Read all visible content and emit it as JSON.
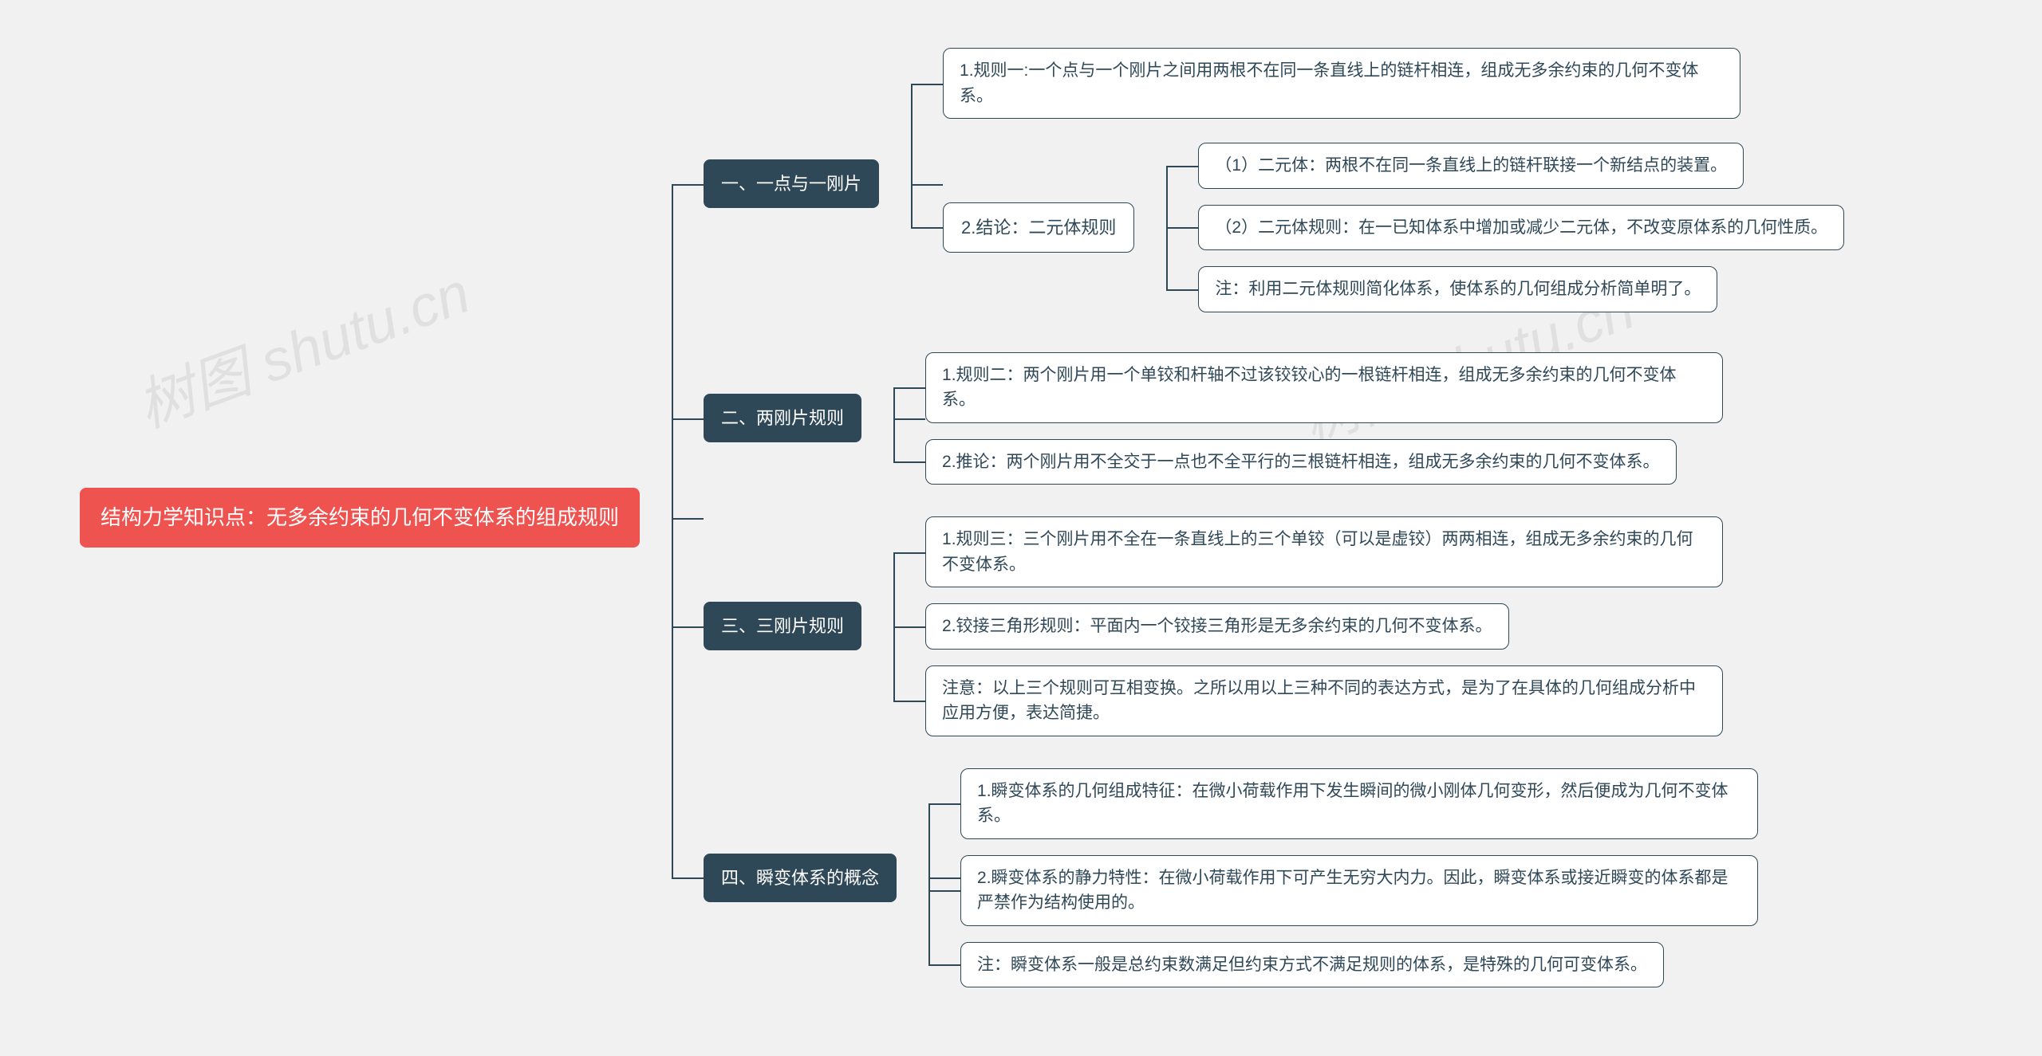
{
  "watermark": "树图 shutu.cn",
  "root": "结构力学知识点：无多余约束的几何不变体系的组成规则",
  "sections": {
    "s1": {
      "title": "一、一点与一刚片",
      "rule1": "1.规则一:一个点与一个刚片之间用两根不在同一条直线上的链杆相连，组成无多余约束的几何不变体系。",
      "conc_title": "2.结论：二元体规则",
      "conc_items": {
        "a": "（1）二元体：两根不在同一条直线上的链杆联接一个新结点的装置。",
        "b": "（2）二元体规则：在一已知体系中增加或减少二元体，不改变原体系的几何性质。",
        "c": "注：利用二元体规则简化体系，使体系的几何组成分析简单明了。"
      }
    },
    "s2": {
      "title": "二、两刚片规则",
      "r1": "1.规则二：两个刚片用一个单铰和杆轴不过该铰铰心的一根链杆相连，组成无多余约束的几何不变体系。",
      "r2": "2.推论：两个刚片用不全交于一点也不全平行的三根链杆相连，组成无多余约束的几何不变体系。"
    },
    "s3": {
      "title": "三、三刚片规则",
      "r1": "1.规则三：三个刚片用不全在一条直线上的三个单铰（可以是虚铰）两两相连，组成无多余约束的几何不变体系。",
      "r2": "2.铰接三角形规则：平面内一个铰接三角形是无多余约束的几何不变体系。",
      "r3": "注意：以上三个规则可互相变换。之所以用以上三种不同的表达方式，是为了在具体的几何组成分析中应用方便，表达简捷。"
    },
    "s4": {
      "title": "四、瞬变体系的概念",
      "r1": "1.瞬变体系的几何组成特征：在微小荷载作用下发生瞬间的微小刚体几何变形，然后便成为几何不变体系。",
      "r2": "2.瞬变体系的静力特性：在微小荷载作用下可产生无穷大内力。因此，瞬变体系或接近瞬变的体系都是严禁作为结构使用的。",
      "r3": "注：瞬变体系一般是总约束数满足但约束方式不满足规则的体系，是特殊的几何可变体系。"
    }
  }
}
